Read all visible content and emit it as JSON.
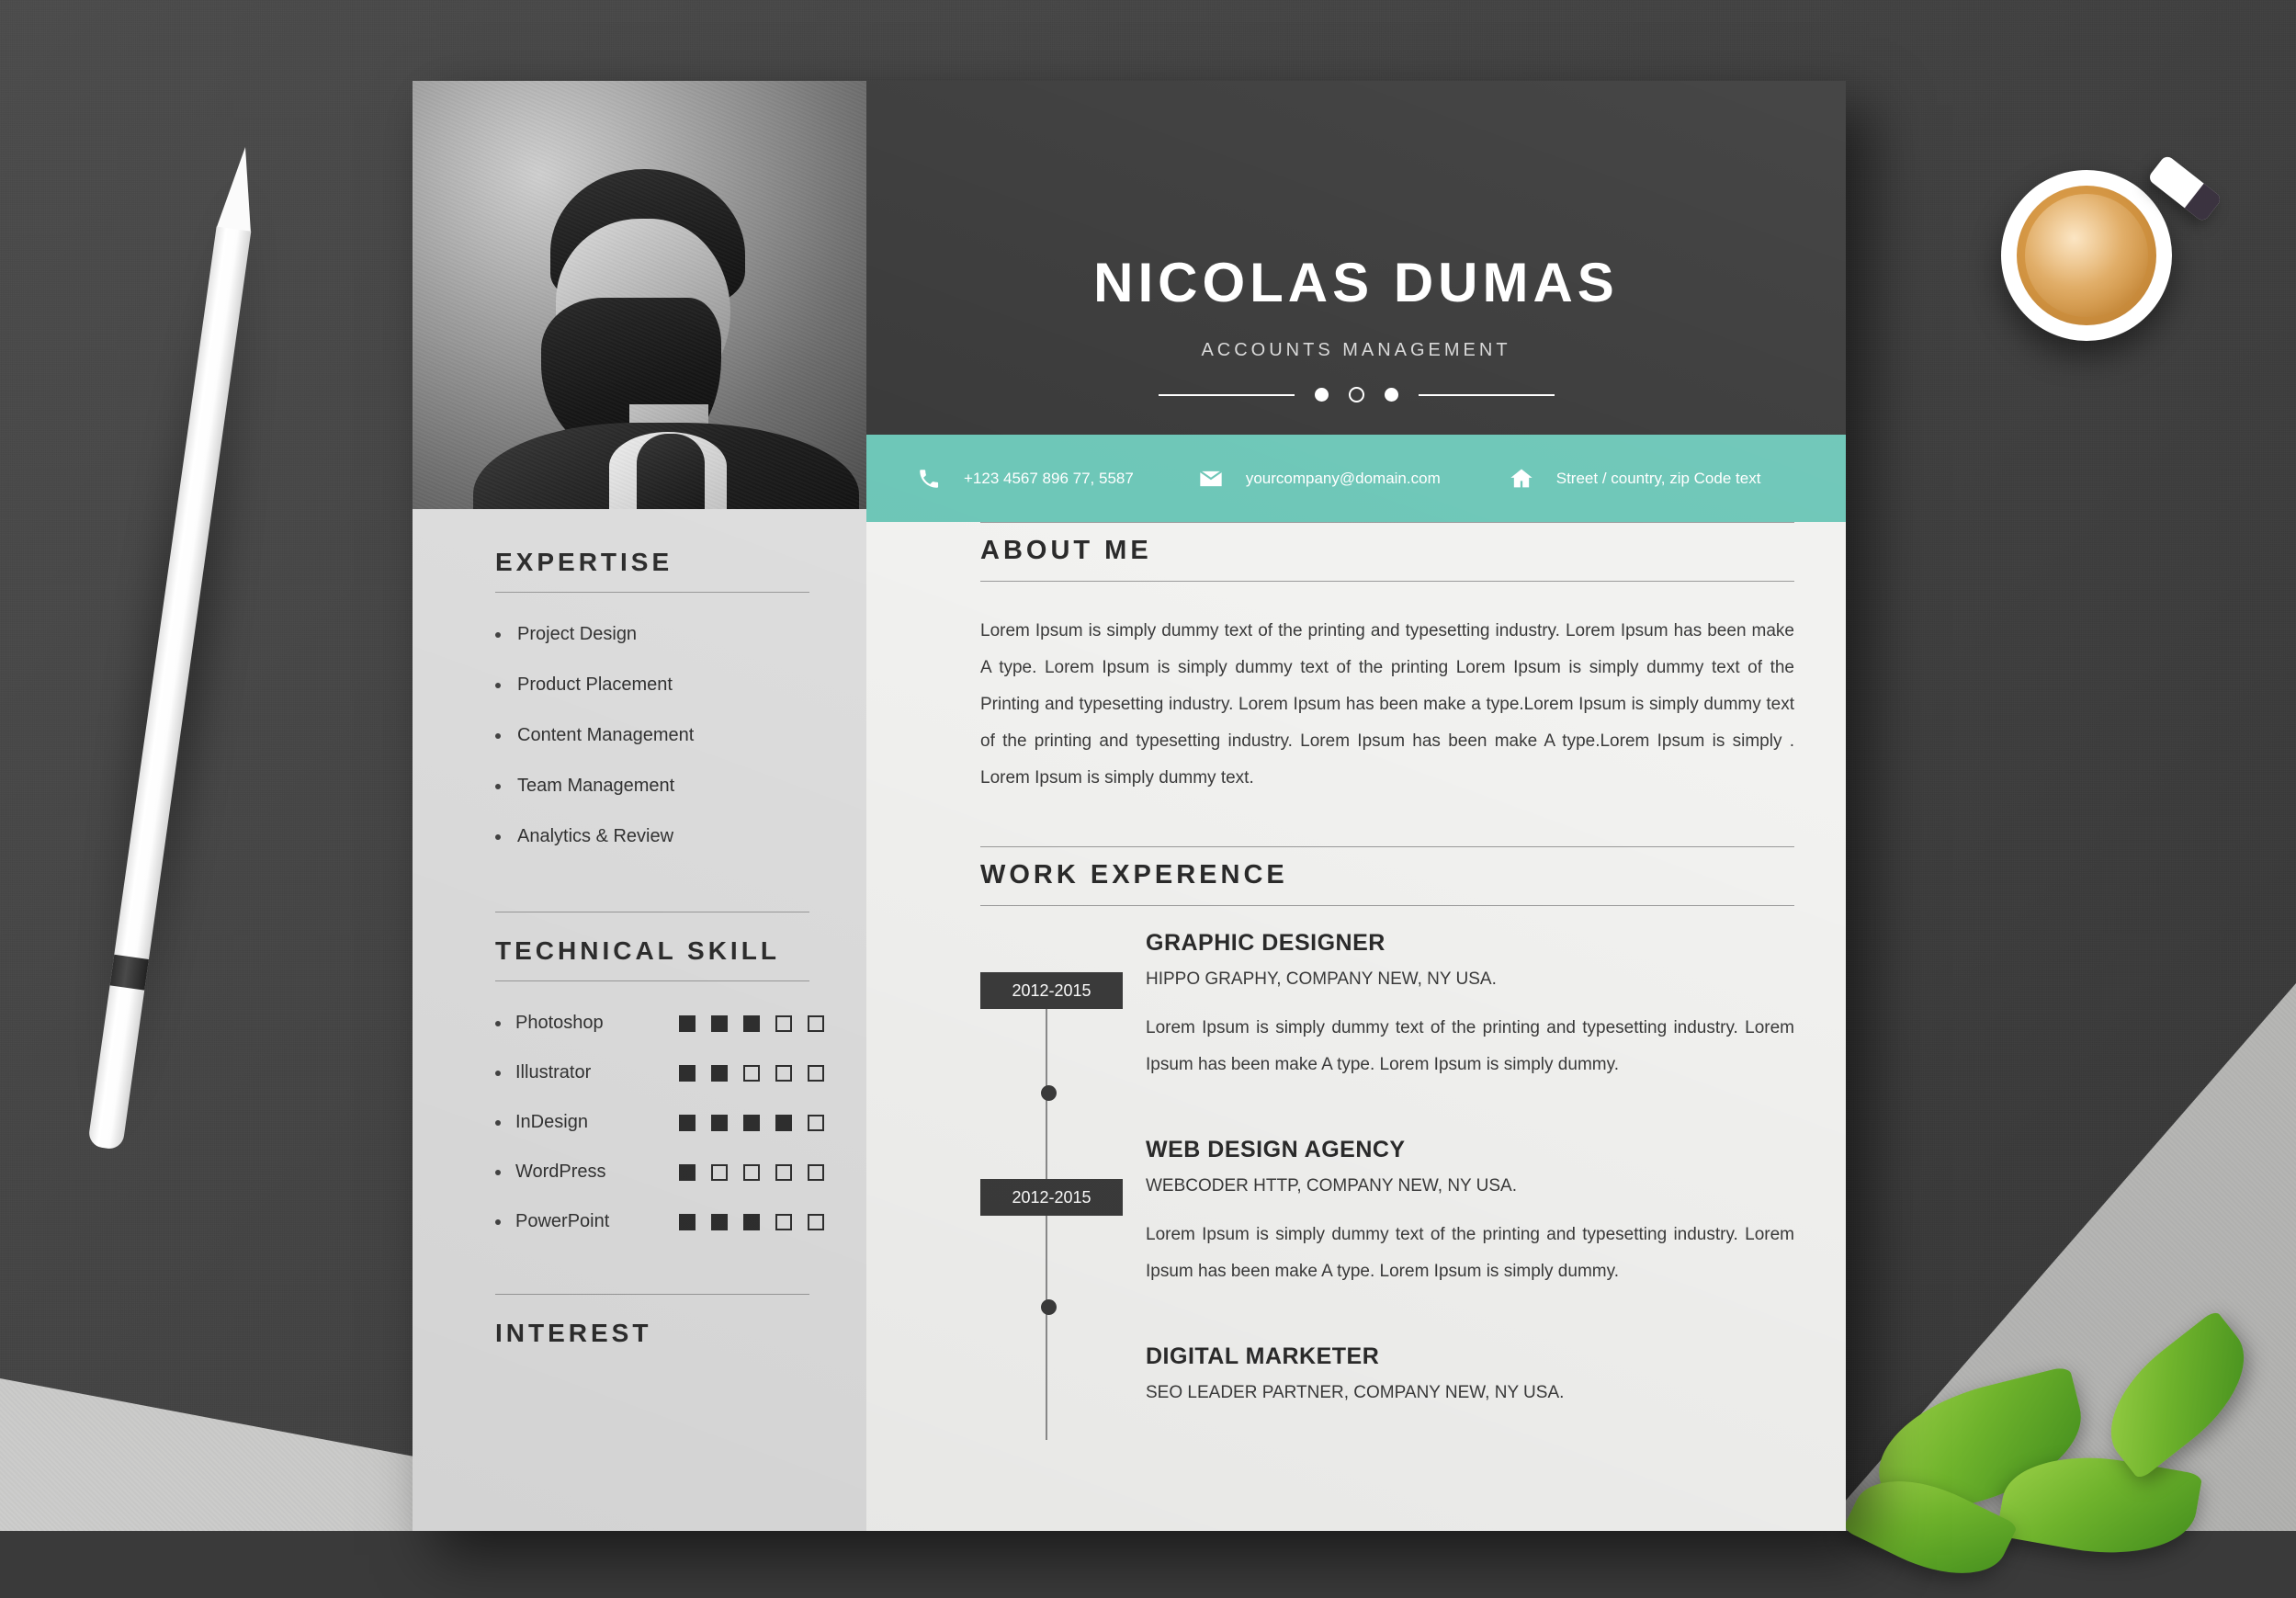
{
  "document": {
    "header": {
      "name": "NICOLAS DUMAS",
      "role": "ACCOUNTS MANAGEMENT",
      "contact": [
        {
          "icon": "phone-icon",
          "glyph": "☎",
          "text": "+123 4567 896 77, 5587"
        },
        {
          "icon": "email-icon",
          "glyph": "✉",
          "text": "yourcompany@domain.com"
        },
        {
          "icon": "home-icon",
          "glyph": "⌂",
          "text": "Street / country, zip Code text"
        }
      ]
    },
    "left_column": {
      "expertise": {
        "title": "EXPERTISE",
        "items": [
          "Project Design",
          "Product Placement",
          "Content Management",
          "Team Management",
          "Analytics & Review"
        ]
      },
      "technical_skill": {
        "title": "TECHNICAL SKILL",
        "items": [
          {
            "name": "Photoshop",
            "filled": 3,
            "total": 5
          },
          {
            "name": "Illustrator",
            "filled": 2,
            "total": 5
          },
          {
            "name": "InDesign",
            "filled": 4,
            "total": 5
          },
          {
            "name": "WordPress",
            "filled": 1,
            "total": 5
          },
          {
            "name": "PowerPoint",
            "filled": 3,
            "total": 5
          }
        ]
      },
      "interest": {
        "title": "INTEREST"
      }
    },
    "right_column": {
      "about": {
        "title": "ABOUT ME",
        "body": "Lorem Ipsum is simply dummy text of the printing and typesetting industry. Lorem Ipsum has been make A type. Lorem Ipsum is simply dummy text of the printing Lorem Ipsum is simply dummy text of the Printing and typesetting industry. Lorem Ipsum has been make a type.Lorem Ipsum is simply dummy text of the printing and typesetting industry. Lorem Ipsum has been make A type.Lorem Ipsum is simply . Lorem Ipsum is simply dummy text."
      },
      "work": {
        "title": "WORK EXPERENCE",
        "jobs": [
          {
            "title": "GRAPHIC DESIGNER",
            "company": "HIPPO GRAPHY, COMPANY NEW, NY USA.",
            "period": "2012-2015",
            "body": "Lorem Ipsum is simply dummy text of the printing and typesetting industry. Lorem Ipsum has been make A type. Lorem Ipsum is simply dummy."
          },
          {
            "title": "WEB DESIGN AGENCY",
            "company": "WEBCODER HTTP, COMPANY NEW, NY USA.",
            "period": "2012-2015",
            "body": "Lorem Ipsum is simply dummy text of the printing and typesetting industry. Lorem Ipsum has been make A type. Lorem Ipsum is simply dummy."
          },
          {
            "title": "DIGITAL MARKETER",
            "company": "SEO LEADER PARTNER, COMPANY NEW, NY USA.",
            "period": "",
            "body": ""
          }
        ]
      }
    },
    "colors": {
      "accent_teal": "#6ec7b8",
      "dark": "#3b3b3b",
      "sidebar": "#dedede",
      "page": "#f2f2f0"
    }
  }
}
